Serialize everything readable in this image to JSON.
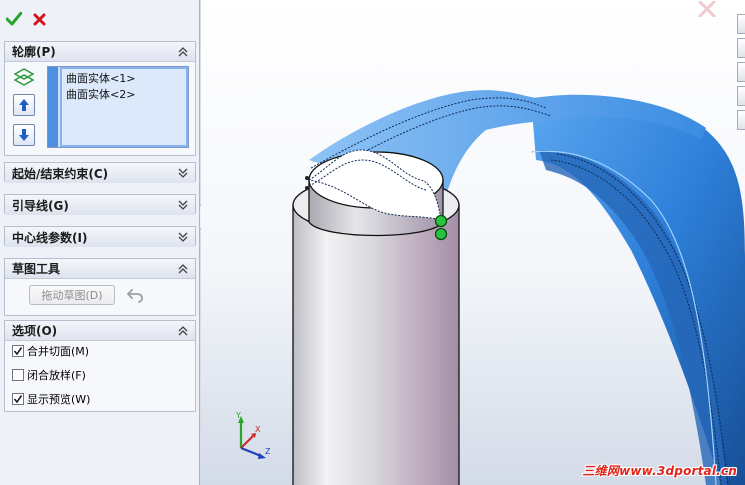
{
  "panel": {
    "profile": {
      "title": "轮廓(P)",
      "items": [
        "曲面实体<1>",
        "曲面实体<2>"
      ]
    },
    "start_end": {
      "title": "起始/结束约束(C)"
    },
    "guide_curves": {
      "title": "引导线(G)"
    },
    "centerline": {
      "title": "中心线参数(I)"
    },
    "sketch_tools": {
      "title": "草图工具",
      "drag_sketch_label": "拖动草图(D)"
    },
    "options": {
      "title": "选项(O)",
      "items": [
        {
          "label": "合并切面(M)",
          "checked": true
        },
        {
          "label": "闭合放样(F)",
          "checked": false
        },
        {
          "label": "显示预览(W)",
          "checked": true
        }
      ]
    }
  },
  "viewport": {
    "triad": {
      "x": "X",
      "y": "Y",
      "z": "Z"
    },
    "watermark": "三维网www.3dportal.cn"
  },
  "colors": {
    "accept": "#27a52b",
    "cancel": "#d4141a",
    "surface_blue": "#3c8fe0",
    "watermark": "#e2261b"
  }
}
